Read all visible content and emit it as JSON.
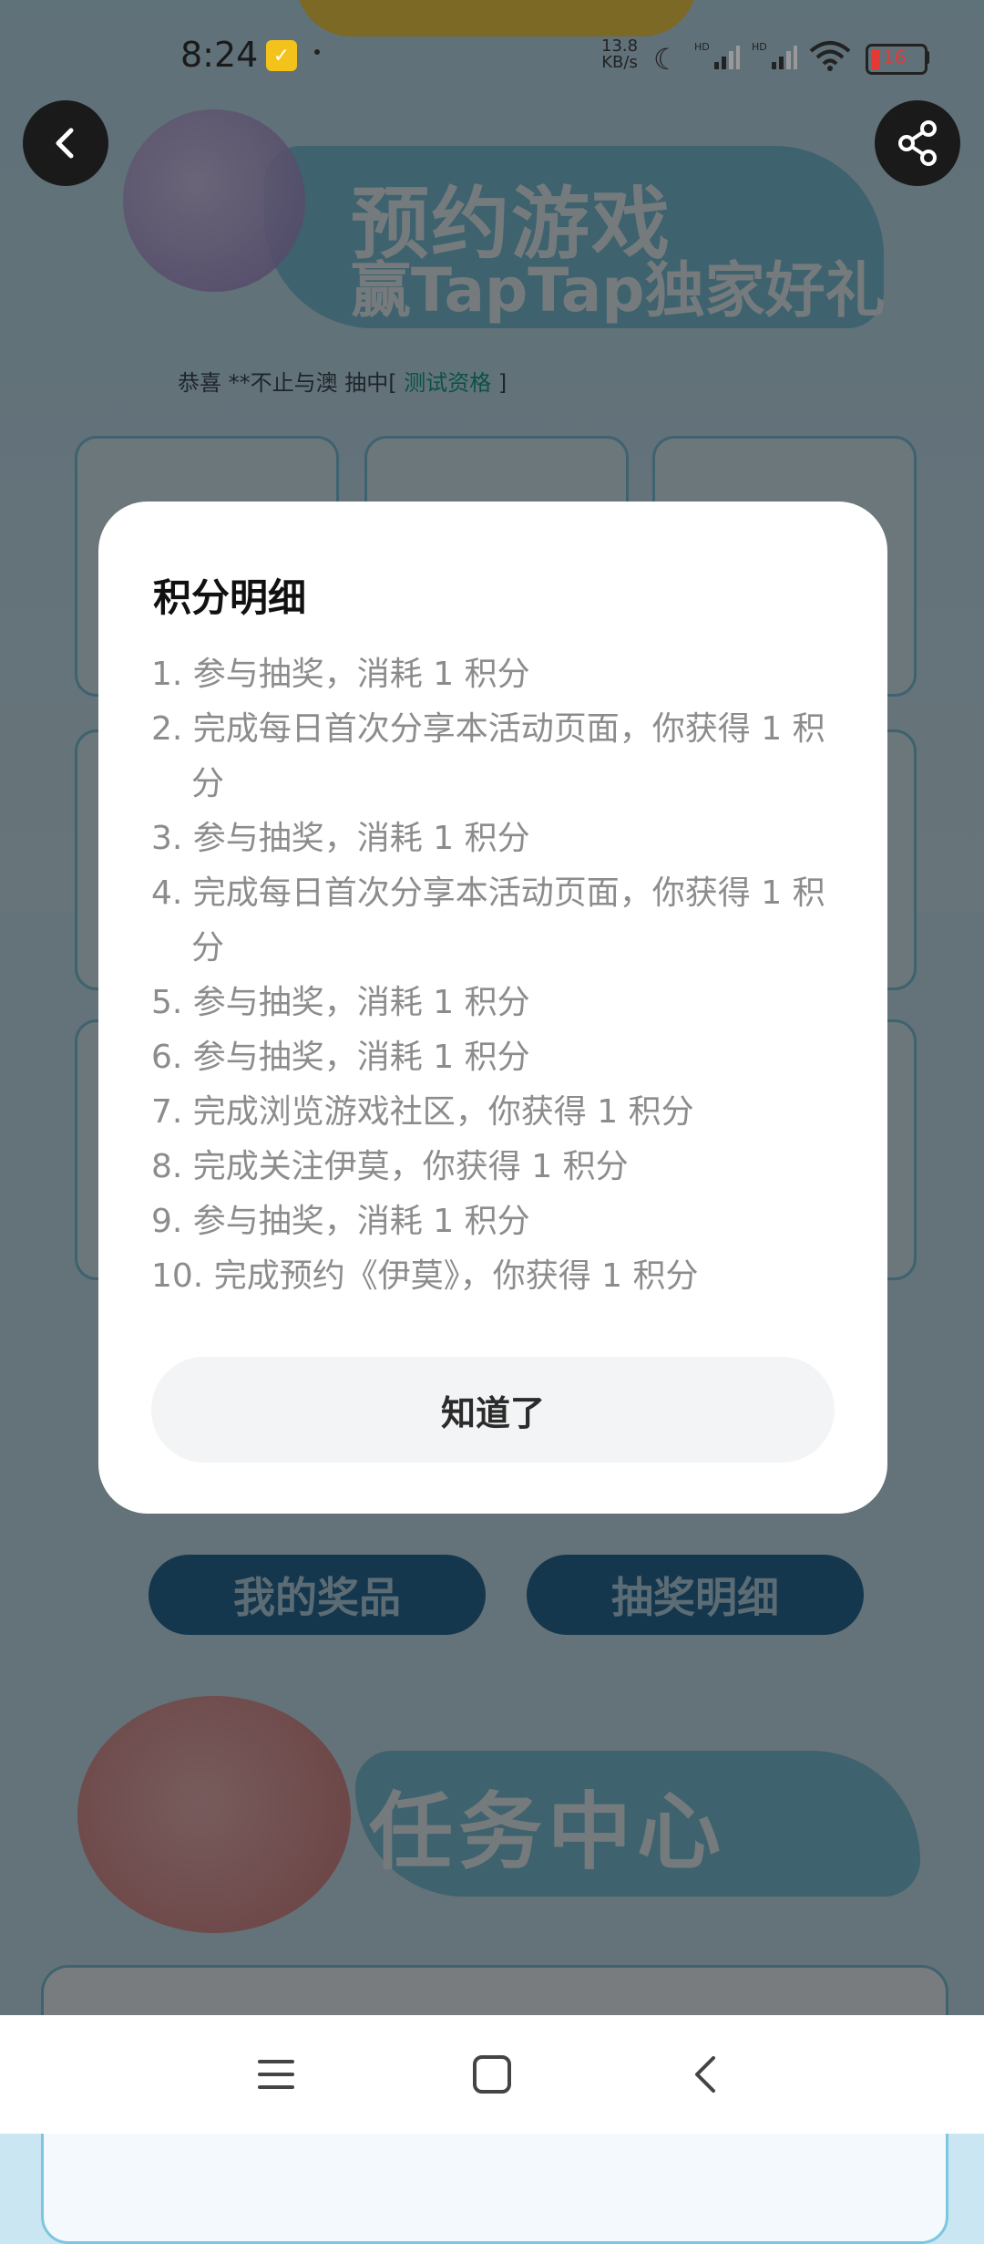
{
  "status_bar": {
    "time": "8:24",
    "speed_value": "13.8",
    "speed_unit": "KB/s",
    "battery": "16",
    "icons": [
      "notification-icon",
      "moon-icon",
      "hd-signal-icon",
      "hd-signal-icon",
      "wifi-icon",
      "battery-icon"
    ]
  },
  "header": {
    "back_icon": "chevron-left-icon",
    "share_icon": "share-icon"
  },
  "background": {
    "banner_line1": "预约游戏",
    "banner_line2": "赢TapTap独家好礼",
    "winner_prefix": "恭喜 **不止与澳 抽中[ ",
    "winner_prize": "测试资格",
    "winner_suffix": " ]",
    "my_prizes_button": "我的奖品",
    "draw_details_button": "抽奖明细",
    "task_center_title": "任务中心"
  },
  "modal": {
    "title": "积分明细",
    "items": [
      "1. 参与抽奖，消耗 1 积分",
      "2. 完成每日首次分享本活动页面，你获得 1 积分",
      "3. 参与抽奖，消耗 1 积分",
      "4. 完成每日首次分享本活动页面，你获得 1 积分",
      "5. 参与抽奖，消耗 1 积分",
      "6. 参与抽奖，消耗 1 积分",
      "7. 完成浏览游戏社区，你获得 1 积分",
      "8. 完成关注伊莫，你获得 1 积分",
      "9. 参与抽奖，消耗 1 积分",
      "10. 完成预约《伊莫》，你获得 1 积分"
    ],
    "confirm_button": "知道了"
  },
  "nav_bar": {
    "menu_icon": "menu-icon",
    "home_icon": "home-square-icon",
    "back_icon": "back-triangle-icon"
  },
  "colors": {
    "overlay": "#000000",
    "modal_bg": "#ffffff",
    "modal_button_bg": "#f3f4f6",
    "winner_highlight": "#17a38a"
  }
}
